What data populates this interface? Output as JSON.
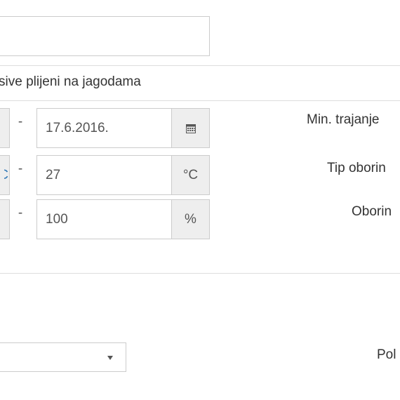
{
  "form": {
    "top_input_value": "",
    "title_row_text": "sive plijeni na jagodama",
    "date_row": {
      "dash": "-",
      "to_value": "17.6.2016.",
      "calendar_icon": "calendar-icon",
      "right_label": "Min. trajanje"
    },
    "temperature_row": {
      "left_addon_partial": "C",
      "dash": "-",
      "to_value": "27",
      "unit": "°C",
      "right_label": "Tip oborin"
    },
    "humidity_row": {
      "dash": "-",
      "to_value": "100",
      "unit": "%",
      "right_label": "Oborin"
    },
    "select": {
      "selected_value": "",
      "caret_icon": "caret-down-icon"
    },
    "bottom_right_label": "Pol"
  }
}
